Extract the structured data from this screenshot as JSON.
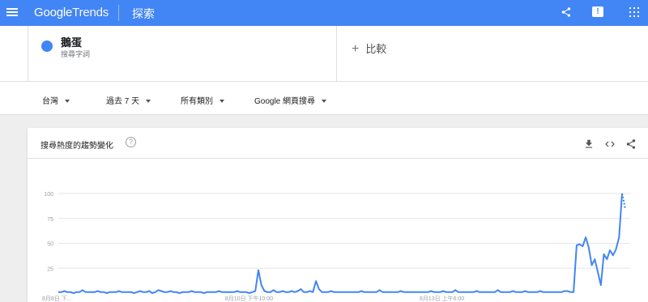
{
  "header": {
    "brand_google": "Google",
    "brand_trends": "Trends",
    "explore_label": "探索",
    "icons": [
      "menu-icon",
      "share-icon",
      "feedback-icon",
      "apps-icon"
    ]
  },
  "term": {
    "name": "鵝蛋",
    "type": "搜尋字詞",
    "color": "#4285f4"
  },
  "compare": {
    "plus": "+",
    "label": "比較"
  },
  "filters": [
    {
      "label": "台灣"
    },
    {
      "label": "過去 7 天"
    },
    {
      "label": "所有類別"
    },
    {
      "label": "Google 網頁搜尋"
    }
  ],
  "card": {
    "title": "搜尋熱度的趨勢變化",
    "help": "?",
    "icons": [
      "download-icon",
      "embed-icon",
      "share-icon"
    ]
  },
  "chart_data": {
    "type": "line",
    "title": "",
    "xlabel": "",
    "ylabel": "",
    "ylim": [
      0,
      100
    ],
    "yticks": [
      100,
      75,
      50,
      25
    ],
    "xtick_labels": [
      "8月8日 下...",
      "8月10日 下午10:00",
      "8月13日 上午6:00"
    ],
    "xtick_positions": [
      0,
      0.32,
      0.66
    ],
    "grid": true,
    "series": [
      {
        "color": "#4285f4",
        "values": [
          1,
          1,
          2,
          1,
          1,
          0,
          1,
          1,
          3,
          1,
          1,
          1,
          1,
          2,
          1,
          1,
          0,
          1,
          1,
          1,
          2,
          1,
          1,
          1,
          1,
          0,
          1,
          2,
          1,
          1,
          2,
          0,
          1,
          3,
          2,
          1,
          1,
          2,
          1,
          1,
          0,
          1,
          1,
          1,
          2,
          1,
          1,
          1,
          0,
          1,
          1,
          1,
          1,
          2,
          1,
          1,
          1,
          1,
          1,
          2,
          1,
          1,
          1,
          0,
          1,
          2,
          23,
          8,
          2,
          1,
          1,
          3,
          1,
          1,
          2,
          1,
          1,
          2,
          1,
          2,
          4,
          1,
          1,
          2,
          1,
          12,
          4,
          1,
          1,
          1,
          2,
          1,
          1,
          1,
          1,
          1,
          1,
          1,
          1,
          1,
          2,
          1,
          1,
          1,
          1,
          1,
          3,
          1,
          1,
          1,
          1,
          1,
          1,
          2,
          1,
          1,
          1,
          1,
          1,
          1,
          1,
          1,
          1,
          2,
          1,
          1,
          1,
          2,
          1,
          1,
          1,
          3,
          1,
          1,
          1,
          1,
          1,
          1,
          2,
          1,
          1,
          1,
          1,
          1,
          1,
          3,
          1,
          1,
          1,
          1,
          2,
          1,
          1,
          1,
          2,
          1,
          1,
          1,
          1,
          2,
          1,
          1,
          1,
          1,
          1,
          1,
          1,
          2,
          2,
          1,
          1,
          48,
          49,
          47,
          56,
          46,
          28,
          34,
          21,
          8,
          39,
          34,
          43,
          38,
          44,
          56,
          100
        ],
        "partial_values": [
          100,
          93,
          85
        ]
      }
    ]
  }
}
